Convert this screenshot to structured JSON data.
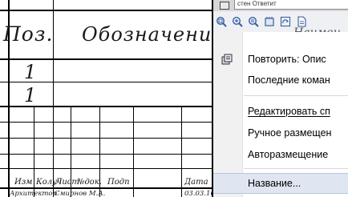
{
  "sheet": {
    "header_pos": "Поз.",
    "header_name": "Обозначение",
    "row1_num": "1",
    "row2_num": "1",
    "title_block": {
      "izm": "Изм",
      "kol_uch": "Колуч",
      "list": "Лист",
      "n_dok": "№док.",
      "podp": "Подп",
      "data": "Дата",
      "razrab_role": "Архитектор",
      "razrab_name": "Смирнов М.А.",
      "date_value": "03.03.16"
    }
  },
  "app": {
    "top_field_text": "стен Ответит",
    "ghost_header": "Наимен",
    "toolbar": [
      {
        "icon": "zoom-to-fit-icon"
      },
      {
        "icon": "zoom-in-icon"
      },
      {
        "icon": "zoom-scale-icon"
      },
      {
        "icon": "pan-icon"
      },
      {
        "icon": "refresh-view-icon"
      },
      {
        "icon": "document-icon"
      }
    ],
    "context_menu": {
      "items": [
        {
          "label": "Повторить: Опис",
          "icon": "repeat-command-icon"
        },
        {
          "label": "Последние коман"
        },
        {
          "label": "Редактировать сп"
        },
        {
          "label": "Ручное размещен"
        },
        {
          "label": "Авторазмещение"
        },
        {
          "label": "Название..."
        }
      ]
    }
  }
}
